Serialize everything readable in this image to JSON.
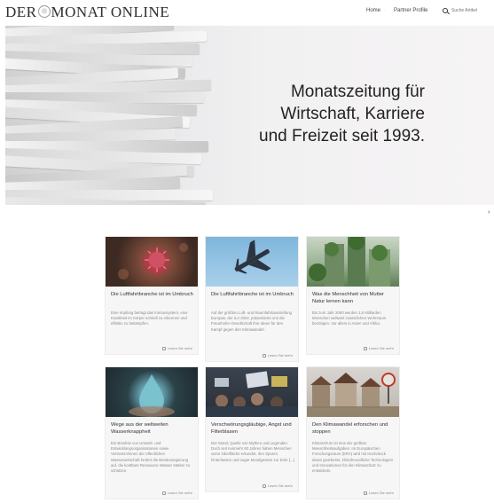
{
  "header": {
    "logo": {
      "part1": "DER",
      "part2": "MONAT ONLINE"
    },
    "nav": {
      "home": "Home",
      "separator": "·",
      "partner": "Partner Profile"
    },
    "search": {
      "placeholder": "Suche Artikel"
    }
  },
  "hero": {
    "title": "Monatszeitung für\nWirtschaft, Karriere\nund Freizeit seit 1993."
  },
  "side_arrow": "›",
  "cards": [
    {
      "title": "Die Luftfahrtbranche ist im Umbruch",
      "text": "Eine Impfung beträgt das Immunsystem, eine Krankheit im Körper schnell zu erkennen und effektiv zu bekämpfen.",
      "readmore": "Lesen Sie mehr"
    },
    {
      "title": "Die Luftfahrtbranche ist im Umbruch",
      "text": "Auf der größten Luft- und Raumfahrtausstellung Europas, der ILA 2022, präsentierte uns die Fraunhofer-Gesellschaft ihre Ideen für den Kampf gegen den Klimawandel.",
      "readmore": "Lesen Sie mehr"
    },
    {
      "title": "Was die Menschheit von Mutter Natur lernen kann",
      "text": "Bis zum Jahr 2050 werden 2,5 Milliarden Menschen weltweit zusätzlichen Wohnraum benötigen. Vor allem in Asien und Afrika.",
      "readmore": "Lesen Sie mehr"
    },
    {
      "title": "Wege aus der weltweiten Wasserknappheit",
      "text": "Ein Bündnis von Umwelt- und Entwicklungsorganisationen sowie Vertretern/innen der öffentlichen Wasserwirtschaft fordert die Bundesregierung auf, die kostbare Ressource Wasser stärker zu schützen.",
      "readmore": "Lesen Sie mehr"
    },
    {
      "title": "Verschwörungsgläubige, Angst und Filterblasen",
      "text": "Der Mond, Quelle von Mythen und Legenden. Doch seit nunmehr 60 Jahren haben Menschen seine Oberfläche erkundet, ihre Spuren hinterlassen und sogar Mondgestein zur Erde [...]",
      "readmore": "Lesen Sie mehr"
    },
    {
      "title": "Den Klimawandel erforschen und stoppen",
      "text": "Klimaschutz ist eine der größten Menschheitsaufgaben. Im Europäischen Forschungsraum (ERA) wird mit Hochdruck daran gearbeitet, klimafreundliche Technologien und Innovationen für den Klimaschutz zu entwickeln.",
      "readmore": "Lesen Sie mehr"
    }
  ]
}
